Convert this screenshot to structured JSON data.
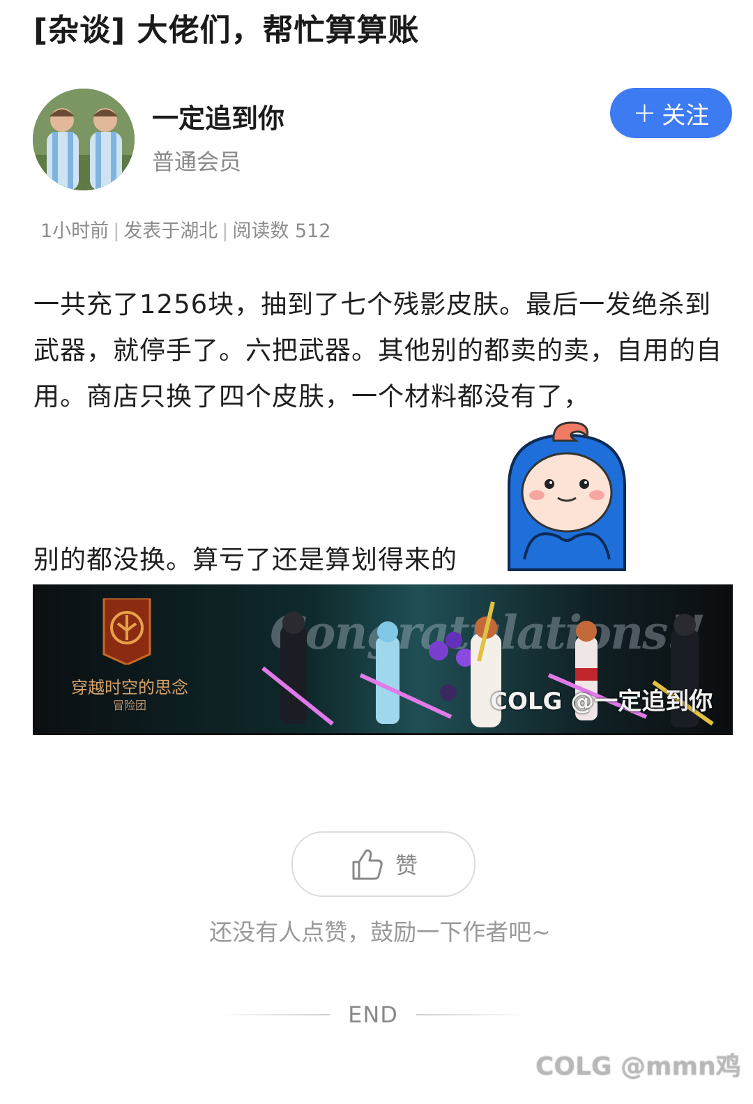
{
  "post": {
    "title": "[杂谈] 大佬们，帮忙算算账",
    "author": {
      "name": "一定追到你",
      "role": "普通会员",
      "follow_label": "关注"
    },
    "meta": {
      "time": "1小时前",
      "location": "发表于湖北",
      "reads": "阅读数 512"
    },
    "body": "一共充了1256块，抽到了七个残影皮肤。最后一发绝杀到武器，就停手了。六把武器。其他别的都卖的卖，自用的自用。商店只换了四个皮肤，一个材料都没有了，",
    "body_last_line": "别的都没换。算亏了还是算划得来的",
    "banner": {
      "congrats_text": "Congratulations!!",
      "guild_name": "穿越时空的思念",
      "guild_sub": "冒险团",
      "watermark": "COLG @一定追到你"
    }
  },
  "actions": {
    "like_label": "赞",
    "like_hint": "还没有人点赞，鼓励一下作者吧~"
  },
  "footer": {
    "end_text": "END",
    "watermark": "COLG @mmn鸡"
  }
}
